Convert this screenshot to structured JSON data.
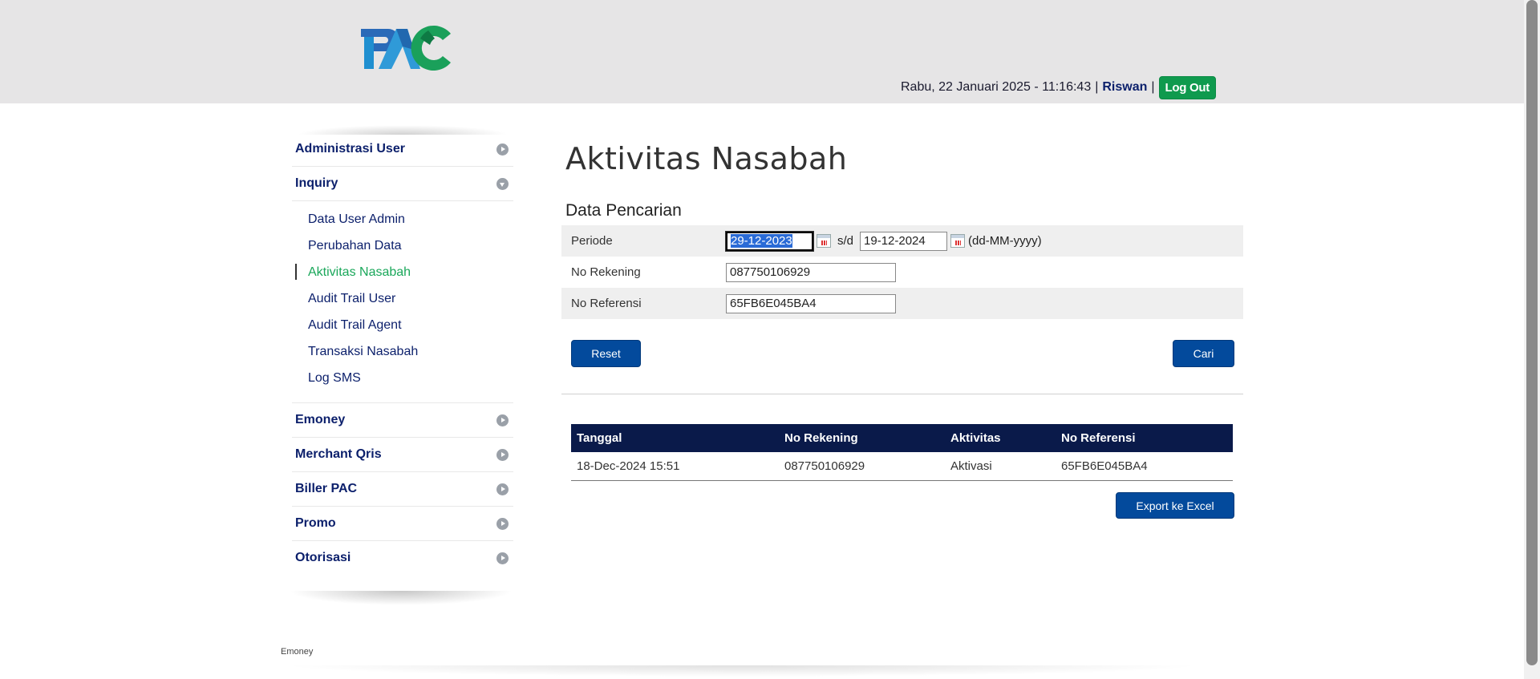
{
  "header": {
    "logo_text": "PAC",
    "datetime": "Rabu, 22 Januari 2025 - 11:16:43",
    "separator": "|",
    "username": "Riswan",
    "logout_label": "Log Out"
  },
  "sidebar": {
    "items": [
      {
        "label": "Administrasi User",
        "expanded": false
      },
      {
        "label": "Inquiry",
        "expanded": true,
        "children": [
          {
            "label": "Data User Admin",
            "active": false
          },
          {
            "label": "Perubahan Data",
            "active": false
          },
          {
            "label": "Aktivitas Nasabah",
            "active": true
          },
          {
            "label": "Audit Trail User",
            "active": false
          },
          {
            "label": "Audit Trail Agent",
            "active": false
          },
          {
            "label": "Transaksi Nasabah",
            "active": false
          },
          {
            "label": "Log SMS",
            "active": false
          }
        ]
      },
      {
        "label": "Emoney",
        "expanded": false
      },
      {
        "label": "Merchant Qris",
        "expanded": false
      },
      {
        "label": "Biller PAC",
        "expanded": false
      },
      {
        "label": "Promo",
        "expanded": false
      },
      {
        "label": "Otorisasi",
        "expanded": false
      }
    ]
  },
  "main": {
    "page_title": "Aktivitas Nasabah",
    "section_title": "Data Pencarian",
    "form": {
      "periode_label": "Periode",
      "date_from": "29-12-2023",
      "sd_text": "s/d",
      "date_to": "19-12-2024",
      "date_format": "(dd-MM-yyyy)",
      "rekening_label": "No Rekening",
      "rekening_value": "087750106929",
      "referensi_label": "No Referensi",
      "referensi_value": "65FB6E045BA4"
    },
    "reset_label": "Reset",
    "cari_label": "Cari",
    "export_label": "Export ke Excel"
  },
  "results": {
    "columns": [
      "Tanggal",
      "No Rekening",
      "Aktivitas",
      "No Referensi"
    ],
    "rows": [
      [
        "18-Dec-2024 15:51",
        "087750106929",
        "Aktivasi",
        "65FB6E045BA4"
      ]
    ]
  },
  "footer": {
    "text": "Emoney"
  },
  "colors": {
    "header_bg": "#e6e5e6",
    "nav_text": "#0b1f6b",
    "active_nav": "#1aa75a",
    "logout_bg": "#0f9a4e",
    "button_bg": "#034a9c",
    "table_header_bg": "#0a1a4a"
  }
}
